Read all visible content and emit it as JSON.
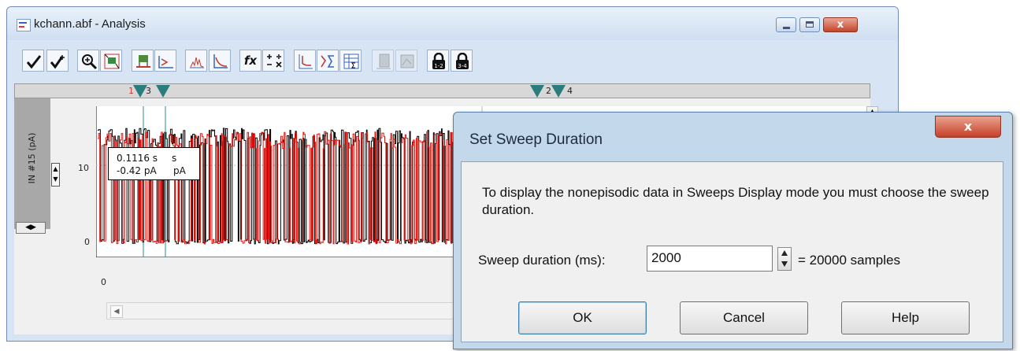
{
  "window": {
    "title": "kchann.abf - Analysis",
    "close_glyph": "x"
  },
  "toolbar": {
    "icons": [
      "check-icon",
      "check-plus-icon",
      "zoom-in-icon",
      "auto-scale-icon",
      "region-zoom-icon",
      "baseline-icon",
      "histogram-icon",
      "fit-curve-icon",
      "formula-icon",
      "arithmetic-icon",
      "event-detect-icon",
      "statistics-icon",
      "results-table-icon",
      "disabled-icon-1",
      "disabled-icon-2",
      "lock-1-2-icon",
      "lock-3-4-icon"
    ]
  },
  "graph": {
    "y_label": "IN #15 (pA)",
    "y_ticks": [
      "10",
      "0"
    ],
    "x_tick": "0",
    "cursor_labels": [
      "1",
      "3",
      "2",
      "4"
    ],
    "readout_line1": "0.1116 s",
    "readout_line2": "-0.42 pA",
    "readout_peek1": "s",
    "readout_peek2": "pA"
  },
  "dialog": {
    "title": "Set Sweep Duration",
    "close_glyph": "x",
    "message": "To display the nonepisodic data in Sweeps Display mode you must choose the sweep duration.",
    "duration_label": "Sweep duration (ms):",
    "duration_value": "2000",
    "samples_text": "= 20000 samples",
    "ok_label": "OK",
    "cancel_label": "Cancel",
    "help_label": "Help"
  },
  "colors": {
    "trace_black": "#000000",
    "trace_red": "#e8140f",
    "cursor": "#2b7d7d"
  }
}
